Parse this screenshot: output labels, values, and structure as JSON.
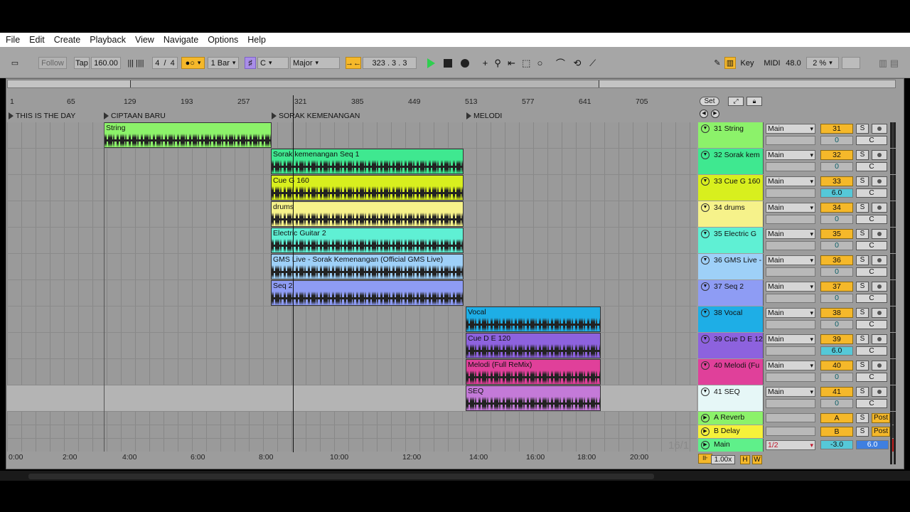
{
  "menu": [
    "File",
    "Edit",
    "Create",
    "Playback",
    "View",
    "Navigate",
    "Options",
    "Help"
  ],
  "toolbar": {
    "follow": "Follow",
    "tap": "Tap",
    "tempo": "160.00",
    "sig_num": "4",
    "sig_sep": "/",
    "sig_den": "4",
    "quant": "1 Bar",
    "key": "C",
    "scale": "Major",
    "position": "323 .  3 .  3",
    "key_btn": "Key",
    "midi_btn": "MIDI",
    "cpu_value": "48.0",
    "cpu_pct": "2 %"
  },
  "ruler": [
    "1",
    "65",
    "129",
    "193",
    "257",
    "321",
    "385",
    "449",
    "513",
    "577",
    "641",
    "705"
  ],
  "locators": [
    "THIS IS THE DAY",
    "CIPTAAN BARU",
    "SORAK KEMENANGAN",
    "MELODI"
  ],
  "time_ruler": [
    "0:00",
    "2:00",
    "4:00",
    "6:00",
    "8:00",
    "10:00",
    "12:00",
    "14:00",
    "16:00",
    "18:00",
    "20:00"
  ],
  "badge": "16/1",
  "set_btn": "Set",
  "clips": [
    {
      "name": "String",
      "color": "#8cf26a"
    },
    {
      "name": "Sorak kemenangan Seq 1",
      "color": "#3fe890"
    },
    {
      "name": "Cue G 160",
      "color": "#d8ef1e"
    },
    {
      "name": "drums",
      "color": "#f6f28a"
    },
    {
      "name": "Electric Guitar 2",
      "color": "#5ff0d4"
    },
    {
      "name": "GMS Live - Sorak Kemenangan (Official GMS Live)",
      "color": "#9ed0f8"
    },
    {
      "name": "Seq 2",
      "color": "#8e9cf4"
    },
    {
      "name": "Vocal",
      "color": "#1eaee6"
    },
    {
      "name": "Cue D E 120",
      "color": "#8d62de"
    },
    {
      "name": "Melodi (Full ReMix)",
      "color": "#e0409a"
    },
    {
      "name": "SEQ",
      "color": "#c47ad8"
    }
  ],
  "tracks": [
    {
      "name": "31 String",
      "route": "Main",
      "num": "31",
      "vol": "0",
      "pan": "C",
      "color": "#8cf26a"
    },
    {
      "name": "32 Sorak kem",
      "route": "Main",
      "num": "32",
      "vol": "0",
      "pan": "C",
      "color": "#3fe890"
    },
    {
      "name": "33 Cue G 160",
      "route": "Main",
      "num": "33",
      "vol": "6.0",
      "pan": "C",
      "color": "#d8ef1e"
    },
    {
      "name": "34 drums",
      "route": "Main",
      "num": "34",
      "vol": "0",
      "pan": "C",
      "color": "#f6f28a"
    },
    {
      "name": "35 Electric G",
      "route": "Main",
      "num": "35",
      "vol": "0",
      "pan": "C",
      "color": "#5ff0d4"
    },
    {
      "name": "36 GMS Live -",
      "route": "Main",
      "num": "36",
      "vol": "0",
      "pan": "C",
      "color": "#9ed0f8"
    },
    {
      "name": "37 Seq 2",
      "route": "Main",
      "num": "37",
      "vol": "0",
      "pan": "C",
      "color": "#8e9cf4"
    },
    {
      "name": "38 Vocal",
      "route": "Main",
      "num": "38",
      "vol": "0",
      "pan": "C",
      "color": "#1eaee6"
    },
    {
      "name": "39 Cue D E 12",
      "route": "Main",
      "num": "39",
      "vol": "6.0",
      "pan": "C",
      "color": "#8d62de"
    },
    {
      "name": "40 Melodi (Fu",
      "route": "Main",
      "num": "40",
      "vol": "0",
      "pan": "C",
      "color": "#e0409a"
    },
    {
      "name": "41 SEQ",
      "route": "Main",
      "num": "41",
      "vol": "0",
      "pan": "C",
      "color": "#e6f7f7"
    }
  ],
  "returns": [
    {
      "name": "A Reverb",
      "num": "A",
      "post": "Post",
      "color": "#8cf26a"
    },
    {
      "name": "B Delay",
      "num": "B",
      "post": "Post",
      "color": "#f6f23a"
    }
  ],
  "master": {
    "name": "Main",
    "route": "1/2",
    "vol": "-3.0",
    "pan": "6.0",
    "color": "#5ff08a"
  },
  "zoom": "1.00x",
  "h_btn": "H",
  "w_btn": "W",
  "solo": "S"
}
